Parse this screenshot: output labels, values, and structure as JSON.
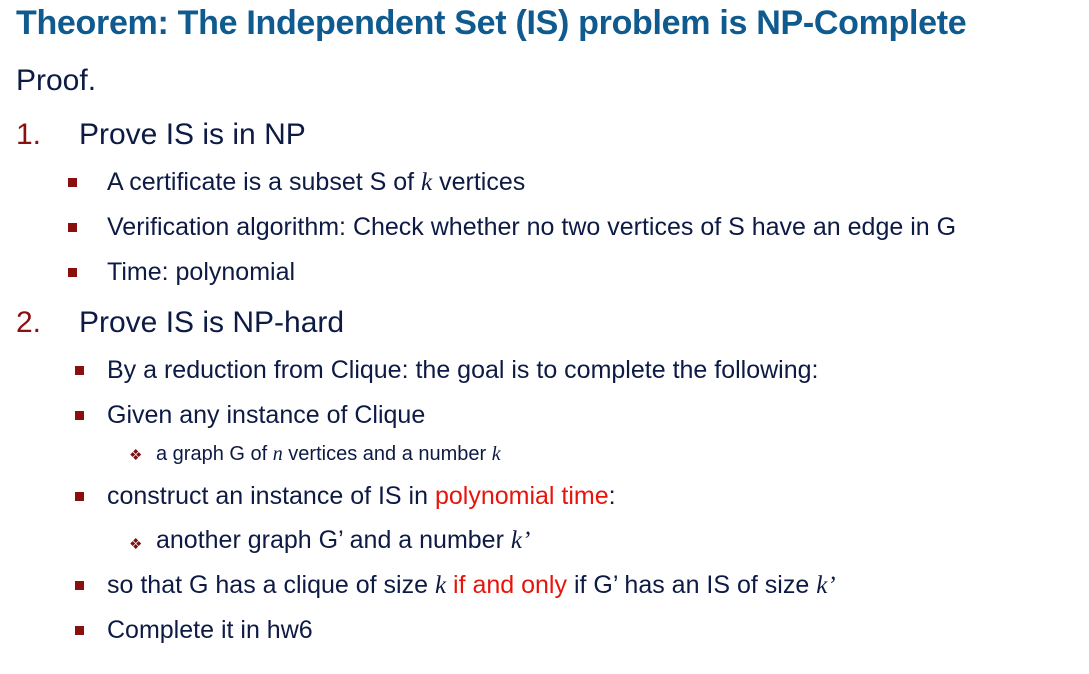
{
  "title": "Theorem: The Independent Set (IS) problem is NP-Complete",
  "proof_label": "Proof.",
  "section1": {
    "number": "1.",
    "heading": "Prove IS is in NP",
    "bullets": [
      {
        "pre": "A certificate is a subset S of ",
        "var": "k",
        "post": " vertices"
      },
      {
        "text": "Verification algorithm: Check whether no two vertices of S have an edge in G"
      },
      {
        "text": "Time: polynomial"
      }
    ]
  },
  "section2": {
    "number": "2.",
    "heading": "Prove IS is NP-hard",
    "b1": "By a reduction from Clique: the goal is to complete the following:",
    "b2": "Given any instance of Clique",
    "b2_sub": {
      "pre": "a graph G of ",
      "var_n": "n",
      "mid": " vertices and a number ",
      "var_k": "k"
    },
    "b3": {
      "pre": "construct an instance of IS in ",
      "red": "polynomial time",
      "post": ":"
    },
    "b3_sub": {
      "pre": "another graph G’ and a number ",
      "var": "k’"
    },
    "b4": {
      "pre": "so that G has a clique of size ",
      "var": "k",
      "red": " if and only",
      "mid": " if G’ has an IS of size ",
      "var2": "k’"
    },
    "b5": "Complete it in hw6"
  },
  "icons": {
    "level2": "square-bullet-icon",
    "level3": "diamond-bullet-icon"
  },
  "colors": {
    "title": "#0f5a8e",
    "text": "#0d1a44",
    "number": "#8a0f0f",
    "highlight": "#e8140c"
  }
}
